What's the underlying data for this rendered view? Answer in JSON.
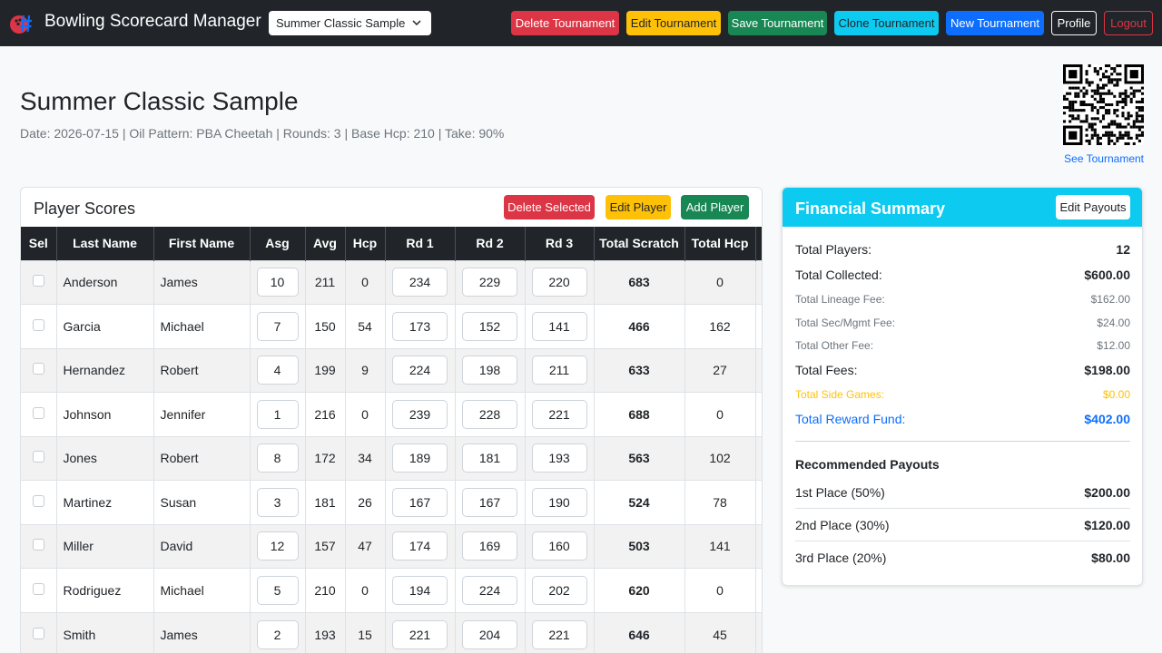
{
  "navbar": {
    "title": "Bowling Scorecard Manager",
    "tournament_select": "Summer Classic Sample",
    "buttons": {
      "delete": "Delete Tournament",
      "edit": "Edit Tournament",
      "save": "Save Tournament",
      "clone": "Clone Tournament",
      "new": "New Tournament",
      "profile": "Profile",
      "logout": "Logout"
    }
  },
  "tournament": {
    "title": "Summer Classic Sample",
    "meta": "Date: 2026-07-15 | Oil Pattern: PBA Cheetah | Rounds: 3 | Base Hcp: 210 | Take: 90%",
    "qr_link": "See Tournament"
  },
  "players": {
    "title": "Player Scores",
    "buttons": {
      "delete_selected": "Delete Selected",
      "edit_player": "Edit Player",
      "add_player": "Add Player"
    },
    "columns": [
      "Sel",
      "Last Name",
      "First Name",
      "Asg",
      "Avg",
      "Hcp",
      "Rd 1",
      "Rd 2",
      "Rd 3",
      "Total Scratch",
      "Total Hcp"
    ],
    "rows": [
      {
        "last": "Anderson",
        "first": "James",
        "asg": "10",
        "avg": "211",
        "hcp": "0",
        "rd1": "234",
        "rd2": "229",
        "rd3": "220",
        "scratch": "683",
        "total_hcp": "0"
      },
      {
        "last": "Garcia",
        "first": "Michael",
        "asg": "7",
        "avg": "150",
        "hcp": "54",
        "rd1": "173",
        "rd2": "152",
        "rd3": "141",
        "scratch": "466",
        "total_hcp": "162"
      },
      {
        "last": "Hernandez",
        "first": "Robert",
        "asg": "4",
        "avg": "199",
        "hcp": "9",
        "rd1": "224",
        "rd2": "198",
        "rd3": "211",
        "scratch": "633",
        "total_hcp": "27"
      },
      {
        "last": "Johnson",
        "first": "Jennifer",
        "asg": "1",
        "avg": "216",
        "hcp": "0",
        "rd1": "239",
        "rd2": "228",
        "rd3": "221",
        "scratch": "688",
        "total_hcp": "0"
      },
      {
        "last": "Jones",
        "first": "Robert",
        "asg": "8",
        "avg": "172",
        "hcp": "34",
        "rd1": "189",
        "rd2": "181",
        "rd3": "193",
        "scratch": "563",
        "total_hcp": "102"
      },
      {
        "last": "Martinez",
        "first": "Susan",
        "asg": "3",
        "avg": "181",
        "hcp": "26",
        "rd1": "167",
        "rd2": "167",
        "rd3": "190",
        "scratch": "524",
        "total_hcp": "78"
      },
      {
        "last": "Miller",
        "first": "David",
        "asg": "12",
        "avg": "157",
        "hcp": "47",
        "rd1": "174",
        "rd2": "169",
        "rd3": "160",
        "scratch": "503",
        "total_hcp": "141"
      },
      {
        "last": "Rodriguez",
        "first": "Michael",
        "asg": "5",
        "avg": "210",
        "hcp": "0",
        "rd1": "194",
        "rd2": "224",
        "rd3": "202",
        "scratch": "620",
        "total_hcp": "0"
      },
      {
        "last": "Smith",
        "first": "James",
        "asg": "2",
        "avg": "193",
        "hcp": "15",
        "rd1": "221",
        "rd2": "204",
        "rd3": "221",
        "scratch": "646",
        "total_hcp": "45"
      }
    ]
  },
  "financial": {
    "title": "Financial Summary",
    "edit_payouts": "Edit Payouts",
    "total_players": {
      "label": "Total Players:",
      "value": "12"
    },
    "total_collected": {
      "label": "Total Collected:",
      "value": "$600.00"
    },
    "lineage_fee": {
      "label": "Total Lineage Fee:",
      "value": "$162.00"
    },
    "sec_fee": {
      "label": "Total Sec/Mgmt Fee:",
      "value": "$24.00"
    },
    "other_fee": {
      "label": "Total Other Fee:",
      "value": "$12.00"
    },
    "total_fees": {
      "label": "Total Fees:",
      "value": "$198.00"
    },
    "side_games": {
      "label": "Total Side Games:",
      "value": "$0.00"
    },
    "reward_fund": {
      "label": "Total Reward Fund:",
      "value": "$402.00"
    },
    "payouts_title": "Recommended Payouts",
    "payouts": [
      {
        "label": "1st Place (50%)",
        "value": "$200.00"
      },
      {
        "label": "2nd Place (30%)",
        "value": "$120.00"
      },
      {
        "label": "3rd Place (20%)",
        "value": "$80.00"
      }
    ]
  },
  "colors": {
    "navbar": "#212529",
    "danger": "#dc3545",
    "warning": "#ffc107",
    "success": "#198754",
    "info": "#0dcaf0",
    "primary": "#0d6efd"
  }
}
